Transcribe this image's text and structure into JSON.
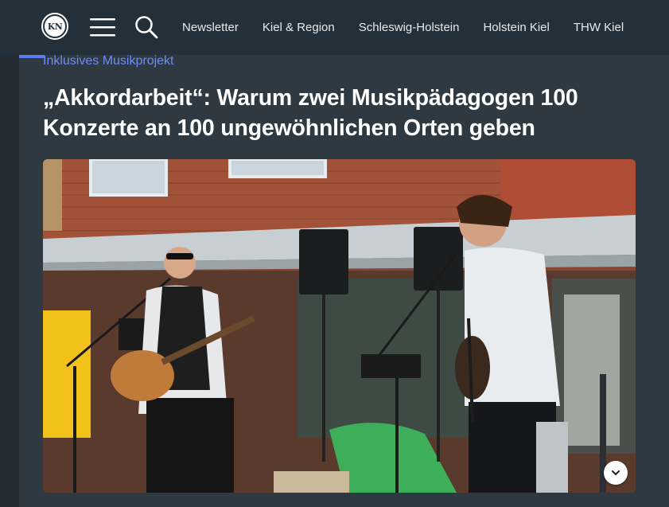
{
  "header": {
    "logo_text": "KN",
    "nav": [
      {
        "label": "Newsletter"
      },
      {
        "label": "Kiel & Region"
      },
      {
        "label": "Schleswig-Holstein"
      },
      {
        "label": "Holstein Kiel"
      },
      {
        "label": "THW Kiel"
      }
    ]
  },
  "article": {
    "kicker": "Inklusives Musikprojekt",
    "headline": "„Akkordarbeit“: Warum zwei Musikpädagogen 100 Konzerte an 100 ungewöhnlichen Orten geben"
  },
  "colors": {
    "header_bg": "#243039",
    "content_bg": "#2e3942",
    "accent": "#5b7cf0",
    "kicker": "#6f8cf5"
  },
  "icons": {
    "menu": "hamburger-menu-icon",
    "search": "search-icon",
    "scroll": "chevron-down-icon"
  }
}
